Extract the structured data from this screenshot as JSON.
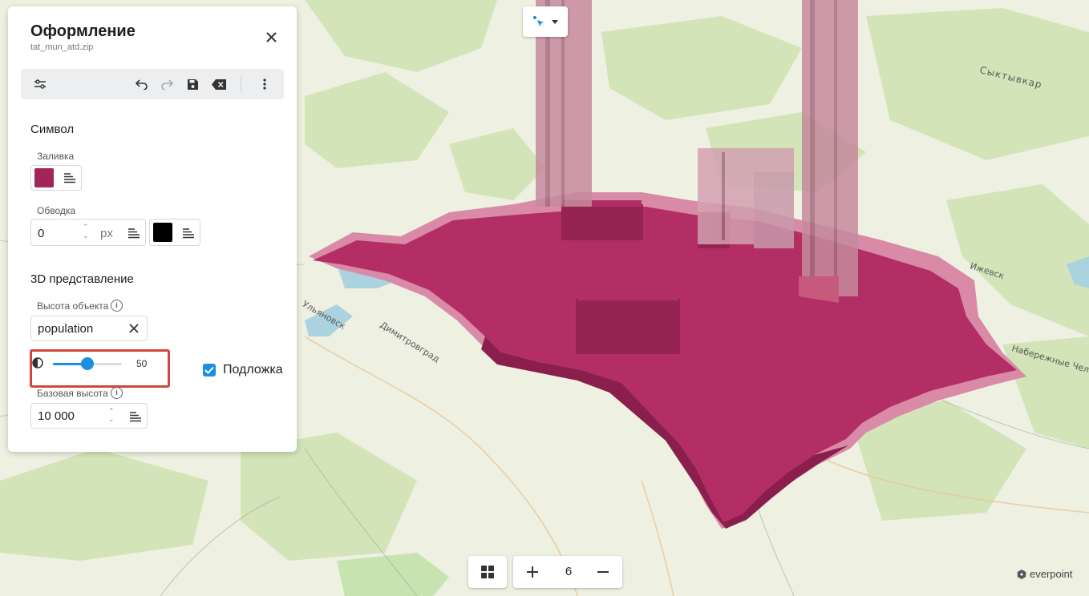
{
  "panel": {
    "title": "Оформление",
    "subtitle": "tat_mun_atd.zip",
    "symbol_section": "Символ",
    "fill_label": "Заливка",
    "fill_color": "#a3245a",
    "stroke_label": "Обводка",
    "stroke_width": "0",
    "stroke_unit": "px",
    "stroke_color": "#000000",
    "view3d_section": "3D представление",
    "height_label": "Высота объекта",
    "height_field": "population",
    "opacity_value": "50",
    "opacity_fraction": 0.5,
    "base_checkbox_label": "Подложка",
    "base_checkbox_checked": true,
    "base_height_label": "Базовая высота",
    "base_height_value": "10 000"
  },
  "toolbar": {
    "icons": [
      "sliders-icon",
      "undo-icon",
      "redo-icon",
      "save-icon",
      "clear-icon",
      "more-icon"
    ]
  },
  "map": {
    "labels": [
      {
        "text": "Ульяновск"
      },
      {
        "text": "Димитровград"
      },
      {
        "text": "Ижевск"
      },
      {
        "text": "Сыктывкар"
      },
      {
        "text": "Набережные Челны"
      }
    ],
    "feature_color": "#b22e65",
    "feature_light_color": "#d98aa6"
  },
  "controls": {
    "zoom_level": "6",
    "brand": "everpoint"
  }
}
